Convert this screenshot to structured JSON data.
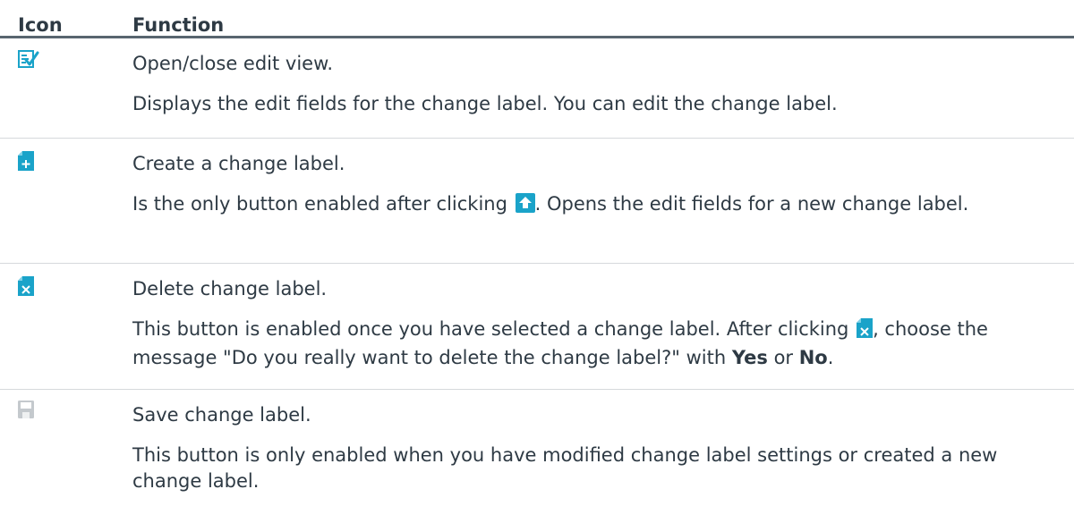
{
  "header": {
    "icon_col": "Icon",
    "function_col": "Function"
  },
  "rows": [
    {
      "icon": "edit-view-icon",
      "title": "Open/close edit view.",
      "description": "Displays the edit fields for the change label. You can edit the change label."
    },
    {
      "icon": "create-label-icon",
      "title": "Create a change label.",
      "description_before": "Is the only button enabled after clicking ",
      "inline_icon": "upload-arrow-icon",
      "description_after": ". Opens the edit fields for a new change label."
    },
    {
      "icon": "delete-label-icon",
      "title": "Delete change label.",
      "description_before": "This button is enabled once you have selected a change label. After clicking ",
      "inline_icon": "delete-label-icon",
      "description_mid": ", choose the message \"Do you really want to delete the change label?\" with ",
      "yes": "Yes",
      "or": " or ",
      "no": "No",
      "end": "."
    },
    {
      "icon": "save-icon",
      "title": "Save change label.",
      "description": "This button is only enabled when you have modified change label settings or created a new change label."
    }
  ],
  "colors": {
    "icon_blue": "#1aa3c9",
    "icon_gray": "#c4c9cd",
    "text": "#2e3a44",
    "header_rule": "#58656f"
  }
}
